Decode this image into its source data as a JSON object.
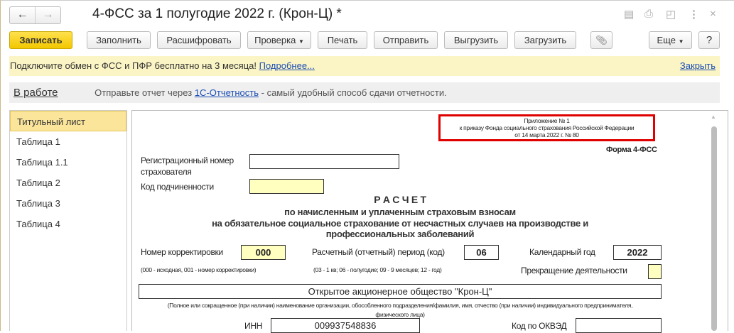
{
  "window": {
    "title": "4-ФСС за 1 полугодие 2022 г. (Крон-Ц) *",
    "back": "←",
    "forward": "→",
    "close": "×"
  },
  "toolbar": {
    "save": "Записать",
    "fill": "Заполнить",
    "decode": "Расшифровать",
    "check": "Проверка",
    "print": "Печать",
    "send": "Отправить",
    "export": "Выгрузить",
    "import": "Загрузить",
    "more": "Еще",
    "help": "?"
  },
  "banner": {
    "text": "Подключите обмен с ФСС и ПФР бесплатно на 3 месяца!",
    "link": "Подробнее...",
    "close": "Закрыть"
  },
  "status": {
    "state": "В работе",
    "prefix": "Отправьте отчет через",
    "link": "1С-Отчетность",
    "suffix": "- самый удобный способ сдачи отчетности."
  },
  "sidebar": {
    "items": [
      {
        "label": "Титульный лист"
      },
      {
        "label": "Таблица 1"
      },
      {
        "label": "Таблица 1.1"
      },
      {
        "label": "Таблица 2"
      },
      {
        "label": "Таблица 3"
      },
      {
        "label": "Таблица 4"
      }
    ]
  },
  "form": {
    "appendix": [
      "Приложение № 1",
      "к приказу Фонда социального страхования Российской Федерации",
      "от 14 марта 2022 г. № 80"
    ],
    "form_name": "Форма 4-ФСС",
    "reg_label": "Регистрационный номер страхователя",
    "reg_value": "",
    "sub_label": "Код подчиненности",
    "sub_value": "",
    "heading": "Р А С Ч Е Т",
    "subheading": [
      "по начисленным и уплаченным страховым взносам",
      "на обязательное социальное страхование от несчастных случаев на производстве и",
      "профессиональных заболеваний"
    ],
    "corr_label": "Номер корректировки",
    "corr_value": "000",
    "corr_note": "(000 - исходная, 001 - номер корректировки)",
    "period_label": "Расчетный (отчетный) период  (код)",
    "period_value": "06",
    "period_note": "(03 - 1 кв; 06 - полугодие; 09 - 9 месяцев; 12 - год)",
    "year_label": "Календарный год",
    "year_value": "2022",
    "stop_label": "Прекращение деятельности",
    "org_name": "Открытое акционерное общество \"Крон-Ц\"",
    "org_note": "(Полное или сокращенное (при наличии) наименование организации, обособленного подразделения/фамилия, имя, отчество (при наличии) индивидуального предпринимателя, физического лица)",
    "inn_label": "ИНН",
    "inn_value": "009937548836",
    "okved_label": "Код по ОКВЭД",
    "okved_value": ""
  }
}
